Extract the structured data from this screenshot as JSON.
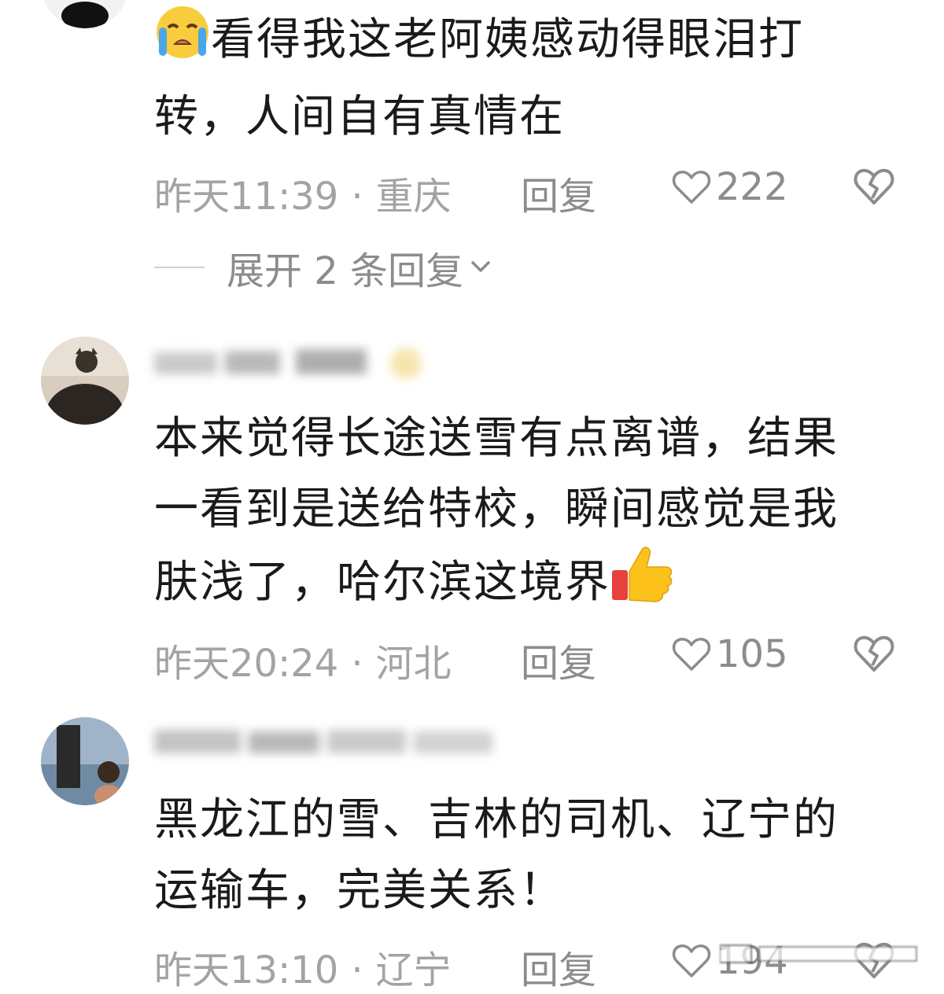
{
  "comments": [
    {
      "username": "",
      "text_line1": "看得我这老阿姨感动得眼泪打",
      "text_line2": "转，人间自有真情在",
      "emoji": "loudly-crying-face",
      "time": "昨天11:39",
      "location": "重庆",
      "reply_label": "回复",
      "likes": "222",
      "expand_label": "展开 2 条回复"
    },
    {
      "username": "",
      "text_line1": "本来觉得长途送雪有点离谱，结果",
      "text_line2": "一看到是送给特校，瞬间感觉是我",
      "text_line3": "肤浅了，哈尔滨这境界",
      "emoji": "thumbs-up",
      "time": "昨天20:24",
      "location": "河北",
      "reply_label": "回复",
      "likes": "105"
    },
    {
      "username": "",
      "text_line1": "黑龙江的雪、吉林的司机、辽宁的",
      "text_line2": "运输车，完美关系！",
      "time": "昨天13:10",
      "location": "辽宁",
      "reply_label": "回复",
      "likes": "194"
    }
  ],
  "separator": "·",
  "colors": {
    "text": "#1a1a1a",
    "meta": "#a3a3a3",
    "action": "#8c8c8c"
  }
}
